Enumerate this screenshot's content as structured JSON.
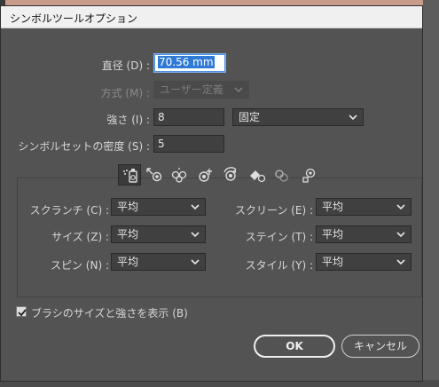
{
  "window": {
    "title": "シンボルツールオプション"
  },
  "diameter": {
    "label": "直径 (D) :",
    "value": "70.56 mm"
  },
  "method": {
    "label": "方式 (M) :",
    "selected": "ユーザー定義"
  },
  "intensity": {
    "label": "強さ (I) :",
    "value": "8",
    "mode": "固定"
  },
  "density": {
    "label": "シンボルセットの密度 (S) :",
    "value": "5"
  },
  "tools": [
    "symbol-sprayer-icon",
    "symbol-shifter-icon",
    "symbol-scruncher-icon",
    "symbol-sizer-icon",
    "symbol-spinner-icon",
    "symbol-stainer-icon",
    "symbol-screener-icon",
    "symbol-styler-icon"
  ],
  "settings": {
    "scrunch": {
      "label": "スクランチ (C) :",
      "value": "平均"
    },
    "size": {
      "label": "サイズ (Z) :",
      "value": "平均"
    },
    "spin": {
      "label": "スピン (N) :",
      "value": "平均"
    },
    "screen": {
      "label": "スクリーン (E) :",
      "value": "平均"
    },
    "stain": {
      "label": "ステイン (T) :",
      "value": "平均"
    },
    "style": {
      "label": "スタイル (Y) :",
      "value": "平均"
    }
  },
  "show_brush": {
    "label": "ブラシのサイズと強さを表示 (B)",
    "checked": true
  },
  "buttons": {
    "ok": "OK",
    "cancel": "キャンセル"
  },
  "colors": {
    "dialog_bg": "#535353",
    "field_bg": "#404040",
    "selection": "#2f7ad6"
  }
}
